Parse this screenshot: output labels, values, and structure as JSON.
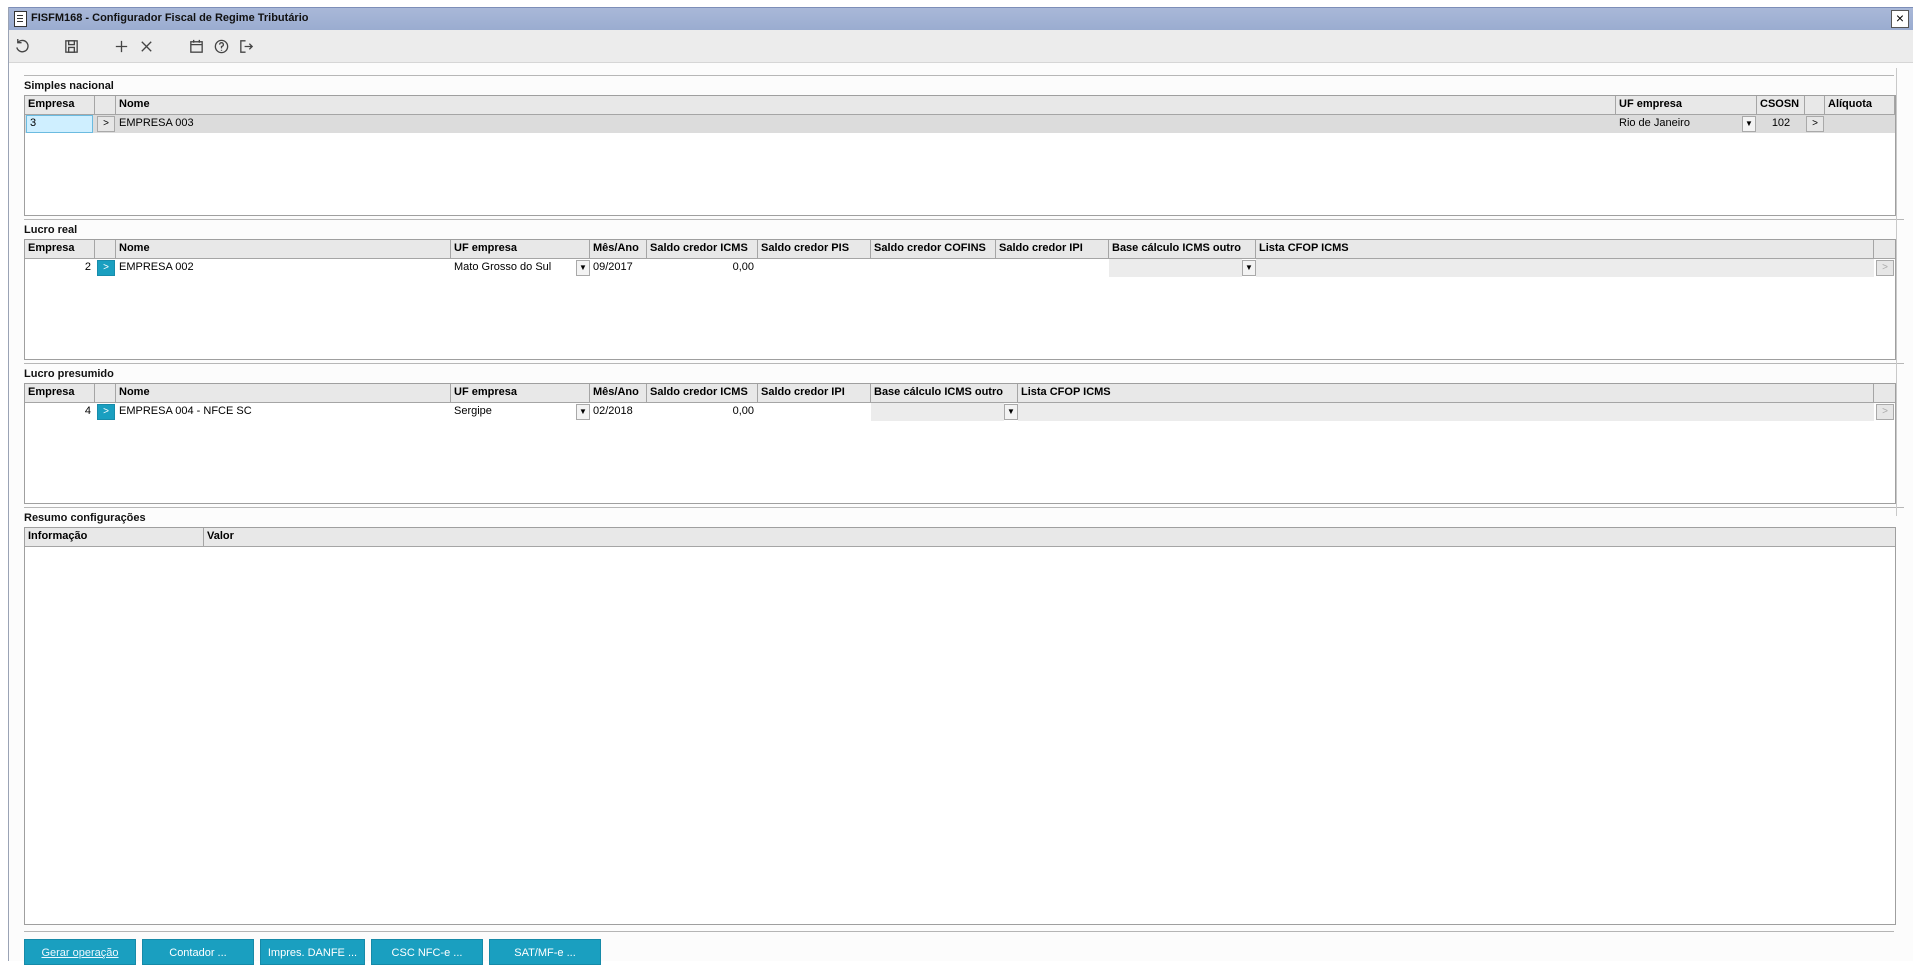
{
  "window": {
    "title": "FISFM168 - Configurador Fiscal de Regime Tributário",
    "close_label": "×"
  },
  "toolbar": {
    "icons": [
      "undo-icon",
      "save-icon",
      "add-icon",
      "delete-icon",
      "calendar-icon",
      "help-icon",
      "exit-icon"
    ]
  },
  "simples": {
    "title": "Simples nacional",
    "headers": [
      "Empresa",
      "",
      "Nome",
      "UF empresa",
      "CSOSN",
      "",
      "Alíquota"
    ],
    "row": {
      "empresa": "3",
      "btn": ">",
      "nome": "EMPRESA 003",
      "uf": "Rio de Janeiro",
      "csosn": "102",
      "btn2": ">",
      "aliquota": ""
    }
  },
  "real": {
    "title": "Lucro real",
    "headers": [
      "Empresa",
      "",
      "Nome",
      "UF empresa",
      "Mês/Ano",
      "Saldo credor ICMS",
      "Saldo credor PIS",
      "Saldo credor COFINS",
      "Saldo credor IPI",
      "Base cálculo ICMS outro",
      "Lista CFOP ICMS"
    ],
    "row": {
      "empresa": "2",
      "btn": ">",
      "nome": "EMPRESA 002",
      "uf": "Mato Grosso do Sul",
      "mesano": "09/2017",
      "icms": "0,00",
      "pis": "",
      "cofins": "",
      "ipi": "",
      "base": "",
      "cfop": "",
      "btn_end": ">"
    }
  },
  "presumido": {
    "title": "Lucro presumido",
    "headers": [
      "Empresa",
      "",
      "Nome",
      "UF empresa",
      "Mês/Ano",
      "Saldo credor ICMS",
      "Saldo credor IPI",
      "Base cálculo ICMS outro",
      "Lista CFOP ICMS"
    ],
    "row": {
      "empresa": "4",
      "btn": ">",
      "nome": "EMPRESA 004 - NFCE SC",
      "uf": "Sergipe",
      "mesano": "02/2018",
      "icms": "0,00",
      "ipi": "",
      "base": "",
      "cfop": "",
      "btn_end": ">"
    }
  },
  "resumo": {
    "title": "Resumo configurações",
    "headers": [
      "Informação",
      "Valor"
    ]
  },
  "footer": {
    "buttons": [
      "Gerar operação",
      "Contador ...",
      "Impres. DANFE ...",
      "CSC NFC-e ...",
      "SAT/MF-e ..."
    ]
  },
  "colors": {
    "accent": "#1a9fc0",
    "title_bar": "#a9b8d8"
  }
}
